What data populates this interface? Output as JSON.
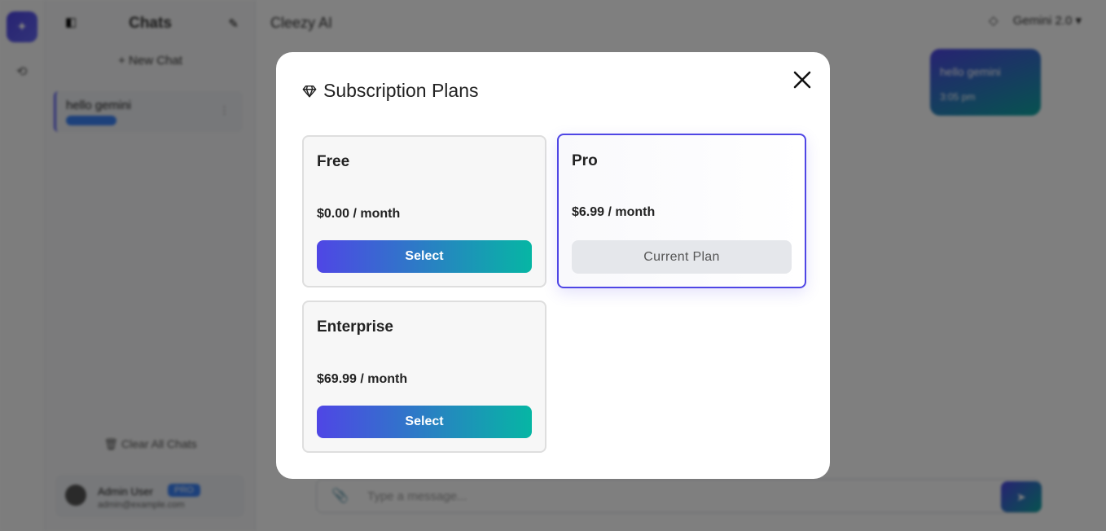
{
  "background": {
    "chats_header": "Chats",
    "new_chat": "+ New Chat",
    "chat_item_title": "hello gemini",
    "clear_all": "Clear All Chats",
    "user_name": "Admin User",
    "user_badge": "PRO",
    "user_email": "admin@example.com",
    "app_title": "Cleezy AI",
    "model": "Gemini 2.0 ▾",
    "bubble_text": "hello gemini",
    "bubble_time": "3:05 pm",
    "composer_placeholder": "Type a message..."
  },
  "modal": {
    "title": "Subscription Plans",
    "icon": "gem-icon",
    "close_icon": "close-icon",
    "plans": [
      {
        "name": "Free",
        "price": "$0.00 / month",
        "button": "Select",
        "current": false
      },
      {
        "name": "Pro",
        "price": "$6.99 / month",
        "button": "Current Plan",
        "current": true
      },
      {
        "name": "Enterprise",
        "price": "$69.99 / month",
        "button": "Select",
        "current": false
      }
    ]
  },
  "colors": {
    "accent": "#4f46e5",
    "accent_end": "#06b6a4",
    "overlay": "rgba(0,0,0,0.5)"
  }
}
